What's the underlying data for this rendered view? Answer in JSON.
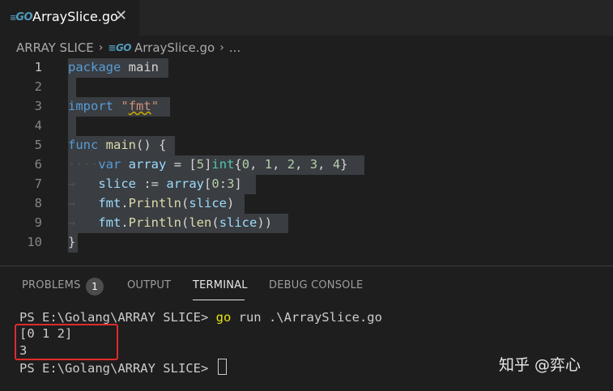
{
  "tab": {
    "icon": "go-file-icon",
    "title": "ArraySlice.go",
    "close": "✕"
  },
  "breadcrumb": {
    "folder": "ARRAY SLICE",
    "sep": "›",
    "file": "ArraySlice.go",
    "more": "..."
  },
  "editor": {
    "line_numbers": [
      "1",
      "2",
      "3",
      "4",
      "5",
      "6",
      "7",
      "8",
      "9",
      "10"
    ],
    "active_line": "1"
  },
  "panel": {
    "tabs": {
      "problems": "PROBLEMS",
      "problems_count": "1",
      "output": "OUTPUT",
      "terminal": "TERMINAL",
      "debug_console": "DEBUG CONSOLE"
    }
  },
  "terminal": {
    "prompt1": "PS E:\\Golang\\ARRAY SLICE> ",
    "cmd_go": "go",
    "cmd_rest": " run .\\ArraySlice.go",
    "out1": "[0 1 2]",
    "out2": "3",
    "prompt2": "PS E:\\Golang\\ARRAY SLICE> "
  },
  "watermark": "知乎 @弈心",
  "colors": {
    "editor_bg": "#1e1e1e",
    "selection": "#3a3d41",
    "keyword": "#569cd6",
    "function": "#dcdcaa",
    "string": "#ce9178",
    "number": "#b5cea8",
    "highlight_box": "#e02b2b"
  }
}
